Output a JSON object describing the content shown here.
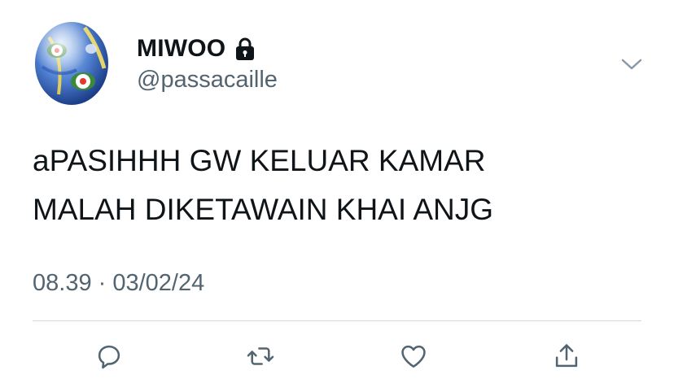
{
  "tweet": {
    "author": {
      "display_name": "MIWOO",
      "handle": "@passacaille",
      "protected": true,
      "avatar_icon": "marble-avatar"
    },
    "text_lines": [
      "aPASIHHH GW KELUAR KAMAR",
      "MALAH DIKETAWAIN KHAI ANJG"
    ],
    "timestamp": "08.39 · 03/02/24",
    "actions": [
      {
        "icon": "reply-icon"
      },
      {
        "icon": "retweet-icon"
      },
      {
        "icon": "like-icon"
      },
      {
        "icon": "share-icon"
      }
    ]
  },
  "colors": {
    "primary_text": "#0f1419",
    "secondary_text": "#536471",
    "divider": "#cfd9de",
    "icon": "#536471"
  }
}
